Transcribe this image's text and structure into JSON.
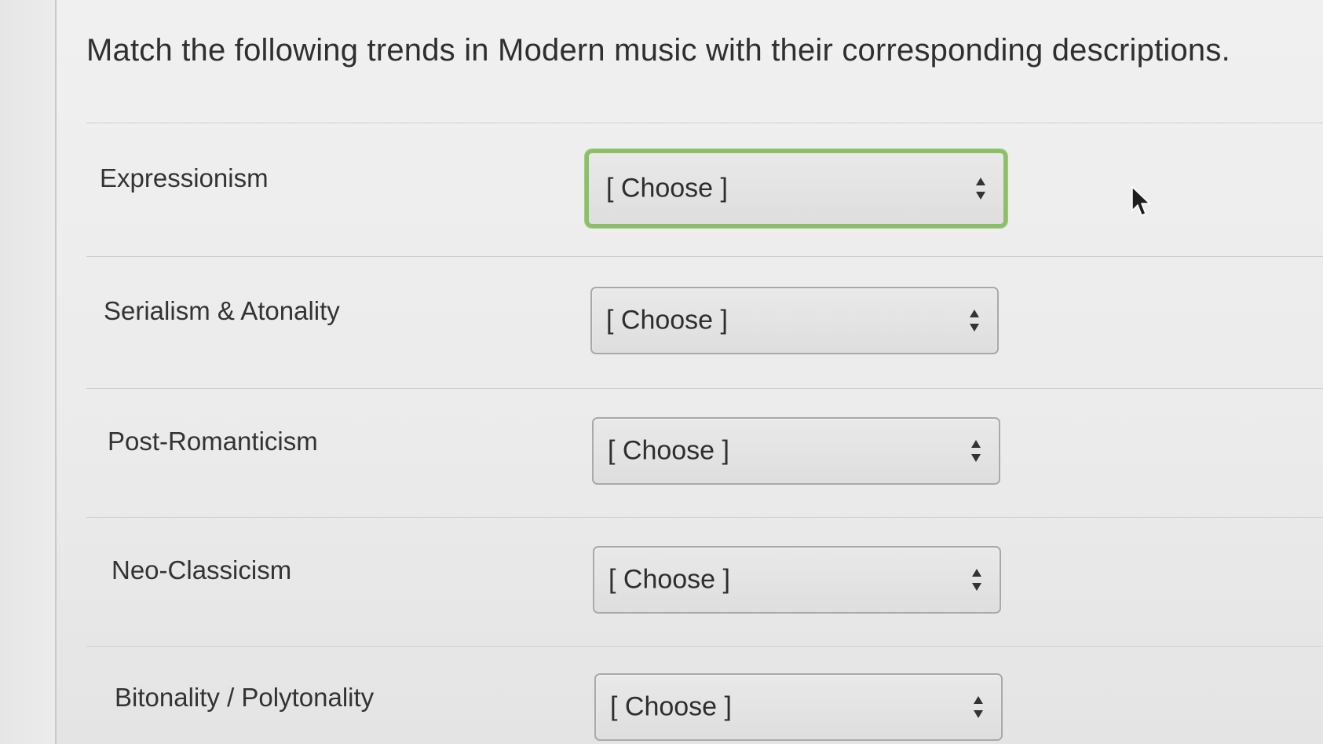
{
  "question": {
    "text": "Match the following trends in Modern music with their corresponding descriptions."
  },
  "rows": [
    {
      "label": "Expressionism",
      "select_value": "[ Choose ]",
      "focused": true
    },
    {
      "label": "Serialism & Atonality",
      "select_value": "[ Choose ]",
      "focused": false
    },
    {
      "label": "Post-Romanticism",
      "select_value": "[ Choose ]",
      "focused": false
    },
    {
      "label": "Neo-Classicism",
      "select_value": "[ Choose ]",
      "focused": false
    },
    {
      "label": "Bitonality / Polytonality",
      "select_value": "[ Choose ]",
      "focused": false
    }
  ],
  "icons": {
    "select_arrows": "up-down-arrows-icon",
    "pointer": "mouse-pointer-icon"
  },
  "colors": {
    "focus_ring": "#8bc068",
    "text": "#2f2f2f",
    "select_border": "#a9a9a9"
  }
}
